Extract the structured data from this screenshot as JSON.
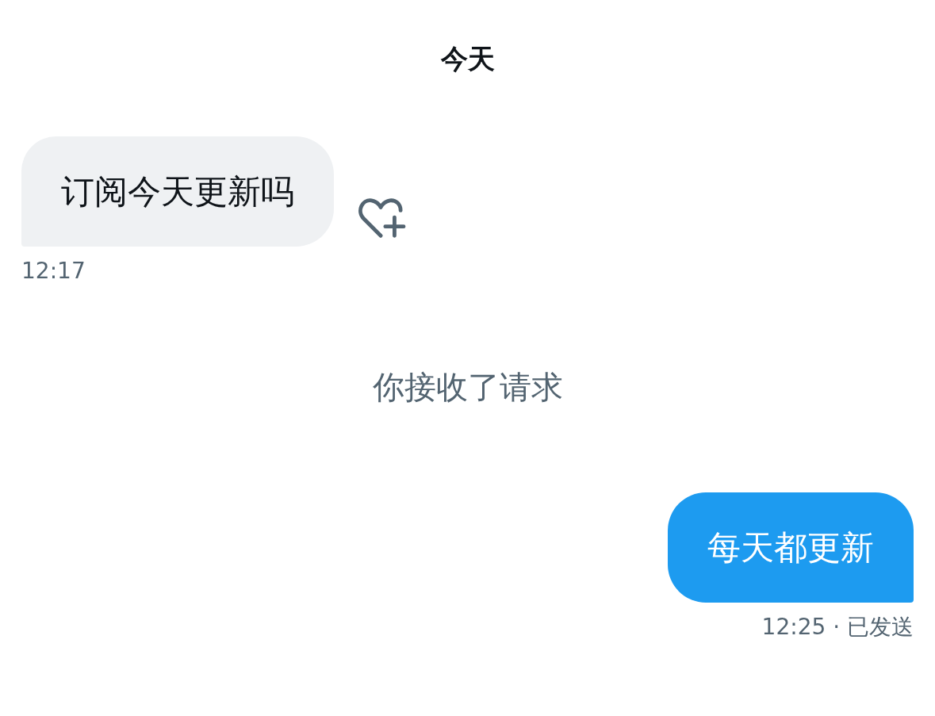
{
  "header": {
    "title": "今天"
  },
  "messages": [
    {
      "kind": "incoming",
      "text": "订阅今天更新吗",
      "meta": "12:17"
    },
    {
      "kind": "system",
      "text": "你接收了请求"
    },
    {
      "kind": "outgoing",
      "text": "每天都更新",
      "meta": "12:25 · 已发送"
    }
  ]
}
